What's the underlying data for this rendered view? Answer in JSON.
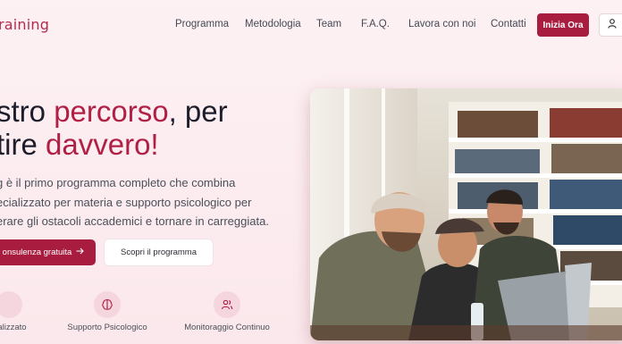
{
  "nav": {
    "logo": "raining",
    "links": [
      "Programma",
      "Metodologia",
      "Team",
      "F.A.Q.",
      "Lavora con noi",
      "Contatti"
    ],
    "cta": "Inizia Ora"
  },
  "hero": {
    "line1_pre": "stro ",
    "line1_accent": "percorso",
    "line1_post": ", per",
    "line2_pre": "tire ",
    "line2_accent": "davvero!",
    "sub_lines": [
      "g è il primo programma completo che combina",
      "ecializzato per materia e supporto psicologico per",
      "erare gli ostacoli accademici e tornare in carreggiata."
    ],
    "primary_button": "onsulenza gratuita",
    "secondary_button": "Scopri il programma"
  },
  "features": [
    {
      "label": "cializzato"
    },
    {
      "label": "Supporto Psicologico"
    },
    {
      "label": "Monitoraggio Continuo"
    }
  ],
  "colors": {
    "accent": "#a81d3f",
    "accent_text": "#b21f45",
    "icon_bg": "#f6d6de"
  }
}
